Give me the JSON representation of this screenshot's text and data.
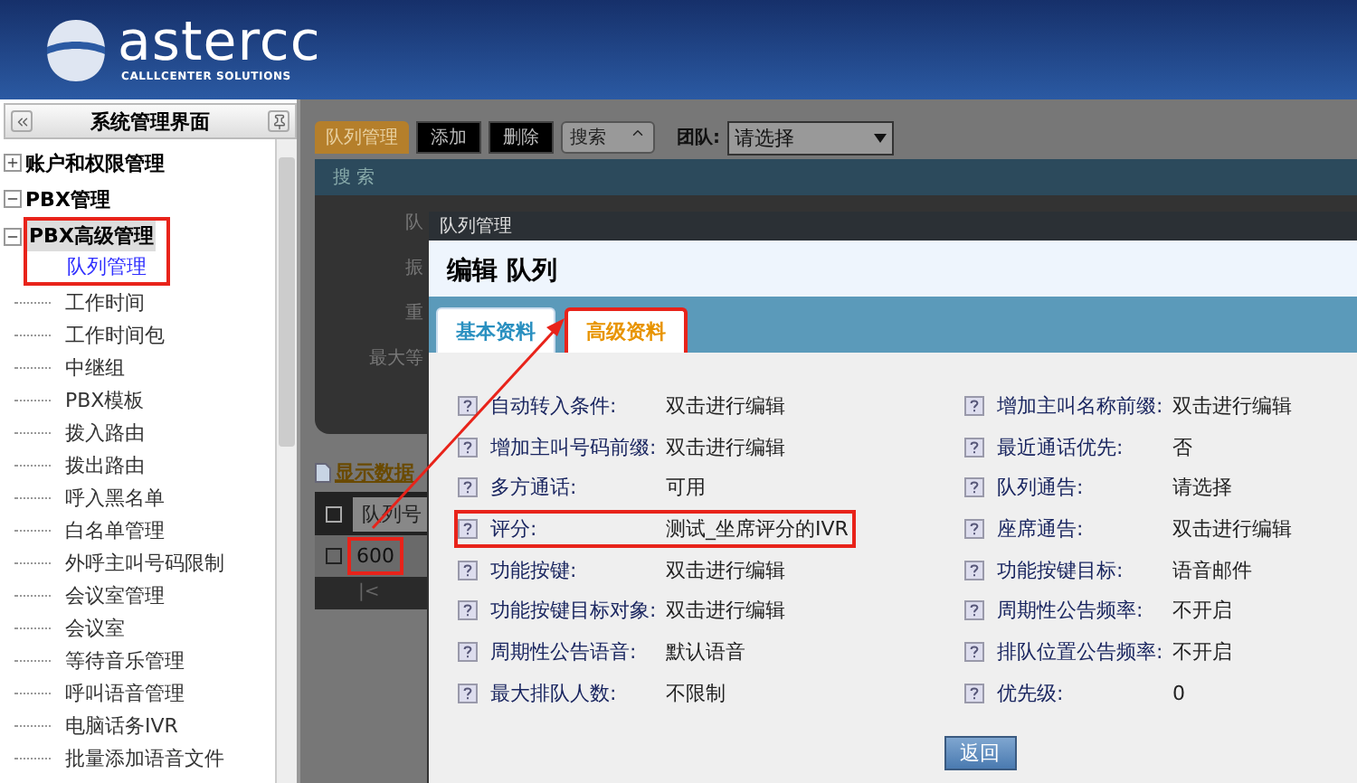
{
  "header": {
    "logo_text": "astercc",
    "tagline": "CALLLCENTER SOLUTIONS"
  },
  "sidebar": {
    "title": "系统管理界面",
    "tree": [
      {
        "label": "账户和权限管理",
        "expanded": false
      },
      {
        "label": "PBX管理",
        "expanded": true
      },
      {
        "label": "PBX高级管理",
        "expanded": true,
        "highlighted": true,
        "children": [
          {
            "label": "队列管理",
            "selected": true
          },
          {
            "label": "工作时间",
            "selected": false
          },
          {
            "label": "工作时间包",
            "selected": false
          },
          {
            "label": "中继组",
            "selected": false
          },
          {
            "label": "PBX模板",
            "selected": false
          },
          {
            "label": "拨入路由",
            "selected": false
          },
          {
            "label": "拨出路由",
            "selected": false
          },
          {
            "label": "呼入黑名单",
            "selected": false
          },
          {
            "label": "白名单管理",
            "selected": false
          },
          {
            "label": "外呼主叫号码限制",
            "selected": false
          },
          {
            "label": "会议室管理",
            "selected": false
          },
          {
            "label": "会议室",
            "selected": false
          },
          {
            "label": "等待音乐管理",
            "selected": false
          },
          {
            "label": "呼叫语音管理",
            "selected": false
          },
          {
            "label": "电脑话务IVR",
            "selected": false
          },
          {
            "label": "批量添加语音文件",
            "selected": false
          }
        ]
      }
    ]
  },
  "toolbar": {
    "tab": "队列管理",
    "buttons": [
      "添加",
      "删除"
    ],
    "search_toggle": "搜索",
    "team_label": "团队:",
    "team_value": "请选择"
  },
  "search_panel": {
    "title": "搜 索",
    "fields": [
      "队",
      "振",
      "重",
      "最大等"
    ]
  },
  "data_link": "显示数据",
  "table": {
    "select_all_checked": false,
    "columns": [
      "队列号"
    ],
    "rows": [
      {
        "cells": [
          "600"
        ],
        "checked": false,
        "highlighted": true
      }
    ],
    "pager": "|<"
  },
  "modal": {
    "title": "队列管理",
    "heading": "编辑 队列",
    "tabs": [
      {
        "label": "基本资料",
        "selected": false,
        "highlighted": false
      },
      {
        "label": "高级资料",
        "selected": true,
        "highlighted": true
      }
    ],
    "left": [
      {
        "label": "自动转入条件:",
        "value": "双击进行编辑",
        "highlighted": false
      },
      {
        "label": "增加主叫号码前缀:",
        "value": "双击进行编辑",
        "highlighted": false
      },
      {
        "label": "多方通话:",
        "value": "可用",
        "highlighted": false
      },
      {
        "label": "评分:",
        "value": "测试_坐席评分的IVR",
        "highlighted": true
      },
      {
        "label": "功能按键:",
        "value": "双击进行编辑",
        "highlighted": false
      },
      {
        "label": "功能按键目标对象:",
        "value": "双击进行编辑",
        "highlighted": false
      },
      {
        "label": "周期性公告语音:",
        "value": "默认语音",
        "highlighted": false
      },
      {
        "label": "最大排队人数:",
        "value": "不限制",
        "highlighted": false
      }
    ],
    "right": [
      {
        "label": "增加主叫名称前缀:",
        "value": "双击进行编辑",
        "highlighted": false
      },
      {
        "label": "最近通话优先:",
        "value": "否",
        "highlighted": false
      },
      {
        "label": "队列通告:",
        "value": "请选择",
        "highlighted": false
      },
      {
        "label": "座席通告:",
        "value": "双击进行编辑",
        "highlighted": false
      },
      {
        "label": "功能按键目标:",
        "value": "语音邮件",
        "highlighted": false
      },
      {
        "label": "周期性公告频率:",
        "value": "不开启",
        "highlighted": false
      },
      {
        "label": "排队位置公告频率:",
        "value": "不开启",
        "highlighted": false
      },
      {
        "label": "优先级:",
        "value": "0",
        "highlighted": false
      }
    ],
    "button": "返回"
  }
}
